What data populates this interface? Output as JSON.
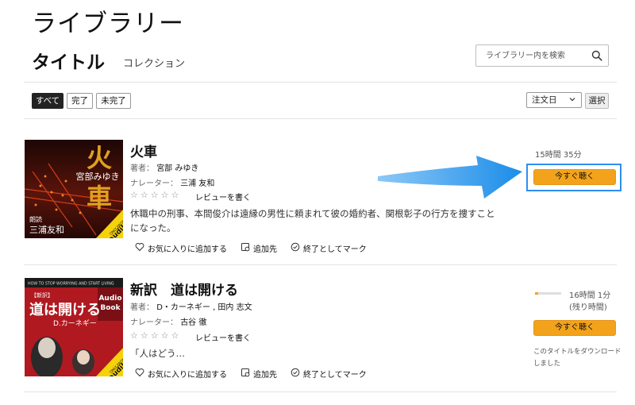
{
  "header": {
    "page_title": "ライブラリー",
    "tab_titles": "タイトル",
    "tab_collection": "コレクション"
  },
  "search": {
    "placeholder": "ライブラリー内を検索"
  },
  "filters": [
    "すべて",
    "完了",
    "未完了"
  ],
  "sort": {
    "selected": "注文日",
    "select_label": "選択"
  },
  "books": [
    {
      "title": "火車",
      "author_label": "著者：",
      "author": "宮部 みゆき",
      "narrator_label": "ナレーター：",
      "narrator": "三浦 友和",
      "stars": "☆☆☆☆☆",
      "review_label": "レビューを書く",
      "summary": "休職中の刑事、本間俊介は遠縁の男性に頼まれて彼の婚約者、関根彰子の行方を捜すことになった。",
      "actions": [
        "お気に入りに追加する",
        "追加先",
        "終了としてマーク"
      ],
      "duration": "15時間 35分",
      "listen_label": "今すぐ聴く",
      "cover": {
        "big_char1": "火",
        "big_char2": "車",
        "author_vertical": "宮部みゆき",
        "narr_small": "朗読",
        "narr_name": "三浦友和",
        "badge_top": "ONLY FROM",
        "badge_main": "audible"
      }
    },
    {
      "title": "新訳　道は開ける",
      "author_label": "著者：",
      "author": "D・カーネギー , 田内 志文",
      "narrator_label": "ナレーター：",
      "narrator": "古谷 徹",
      "stars": "☆☆☆☆☆",
      "review_label": "レビューを書く",
      "summary": "「人はどう…",
      "actions": [
        "お気に入りに追加する",
        "追加先",
        "終了としてマーク"
      ],
      "duration": "16時間 1分",
      "remaining": "(残り時間)",
      "progress": 0.12,
      "listen_label": "今すぐ聴く",
      "download_note": "このタイトルをダウンロードしました",
      "cover": {
        "en_title": "HOW TO STOP WORRYING AND START LIVING",
        "audio": "Audio",
        "book": "Book",
        "shinyaku": "【新訳】",
        "main_title": "道は開ける",
        "author": "D.カーネギー",
        "badge_top": "ONLY FROM",
        "badge_main": "audible"
      }
    }
  ],
  "colors": {
    "accent": "#f3a31b",
    "highlight": "#2d8ef0"
  }
}
